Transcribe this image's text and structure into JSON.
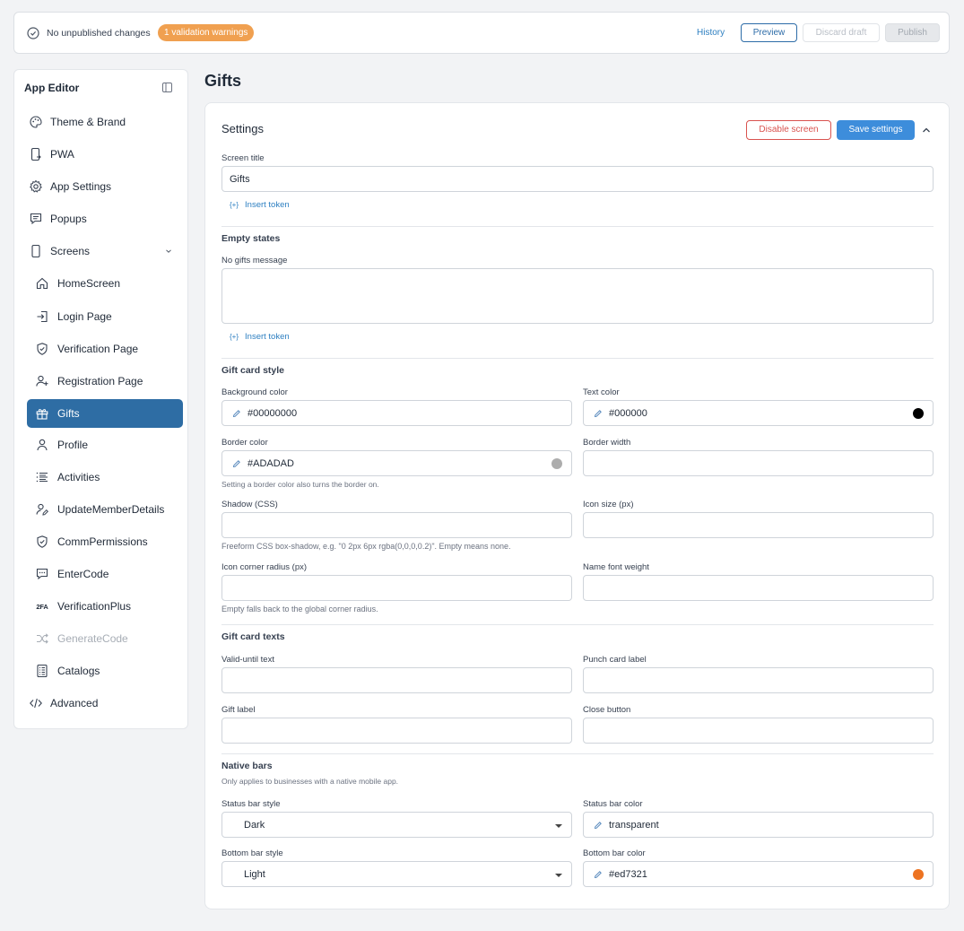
{
  "topbar": {
    "status_text": "No unpublished changes",
    "warning_badge": "1 validation warnings",
    "history_label": "History",
    "preview_label": "Preview",
    "discard_label": "Discard draft",
    "publish_label": "Publish"
  },
  "sidebar": {
    "title": "App Editor",
    "items": [
      {
        "label": "Theme & Brand",
        "icon": "palette-icon"
      },
      {
        "label": "PWA",
        "icon": "phone-arrow-icon"
      },
      {
        "label": "App Settings",
        "icon": "settings-icon"
      },
      {
        "label": "Popups",
        "icon": "message-icon"
      },
      {
        "label": "Screens",
        "icon": "phone-icon"
      }
    ],
    "screens": [
      {
        "label": "HomeScreen",
        "icon": "home-icon"
      },
      {
        "label": "Login Page",
        "icon": "login-icon"
      },
      {
        "label": "Verification Page",
        "icon": "shield-icon"
      },
      {
        "label": "Registration Page",
        "icon": "user-plus-icon"
      },
      {
        "label": "Gifts",
        "icon": "gift-icon",
        "active": true
      },
      {
        "label": "Profile",
        "icon": "user-icon"
      },
      {
        "label": "Activities",
        "icon": "list-icon"
      },
      {
        "label": "UpdateMemberDetails",
        "icon": "user-edit-icon"
      },
      {
        "label": "CommPermissions",
        "icon": "shield-icon"
      },
      {
        "label": "EnterCode",
        "icon": "chat-code-icon"
      },
      {
        "label": "VerificationPlus",
        "icon": "2fa-icon",
        "icon_text": "2FA"
      },
      {
        "label": "GenerateCode",
        "icon": "shuffle-icon",
        "disabled": true
      },
      {
        "label": "Catalogs",
        "icon": "document-list-icon"
      }
    ],
    "advanced": {
      "label": "Advanced",
      "icon": "code-icon"
    }
  },
  "page": {
    "title": "Gifts"
  },
  "settings": {
    "title": "Settings",
    "disable_label": "Disable screen",
    "save_label": "Save settings",
    "screen_title_label": "Screen title",
    "screen_title_value": "Gifts",
    "insert_token_label": "Insert token",
    "insert_token_glyph": "{+}"
  },
  "empty_states": {
    "heading": "Empty states",
    "no_gifts_label": "No gifts message",
    "no_gifts_value": ""
  },
  "gift_card_style": {
    "heading": "Gift card style",
    "background_color_label": "Background color",
    "background_color_value": "#00000000",
    "text_color_label": "Text color",
    "text_color_value": "#000000",
    "text_color_swatch": "#000000",
    "border_color_label": "Border color",
    "border_color_value": "#ADADAD",
    "border_color_swatch": "#ADADAD",
    "border_color_hint": "Setting a border color also turns the border on.",
    "border_width_label": "Border width",
    "shadow_label": "Shadow (CSS)",
    "shadow_hint": "Freeform CSS box-shadow, e.g. \"0 2px 6px rgba(0,0,0,0.2)\". Empty means none.",
    "icon_size_label": "Icon size (px)",
    "icon_radius_label": "Icon corner radius (px)",
    "icon_radius_hint": "Empty falls back to the global corner radius.",
    "name_weight_label": "Name font weight"
  },
  "gift_card_texts": {
    "heading": "Gift card texts",
    "valid_until_label": "Valid-until text",
    "punch_card_label": "Punch card label",
    "gift_label_label": "Gift label",
    "close_button_label": "Close button"
  },
  "native_bars": {
    "heading": "Native bars",
    "hint": "Only applies to businesses with a native mobile app.",
    "status_style_label": "Status bar style",
    "status_style_value": "Dark",
    "status_color_label": "Status bar color",
    "status_color_value": "transparent",
    "bottom_style_label": "Bottom bar style",
    "bottom_style_value": "Light",
    "bottom_color_label": "Bottom bar color",
    "bottom_color_value": "#ed7321",
    "bottom_color_swatch": "#ed7321"
  }
}
